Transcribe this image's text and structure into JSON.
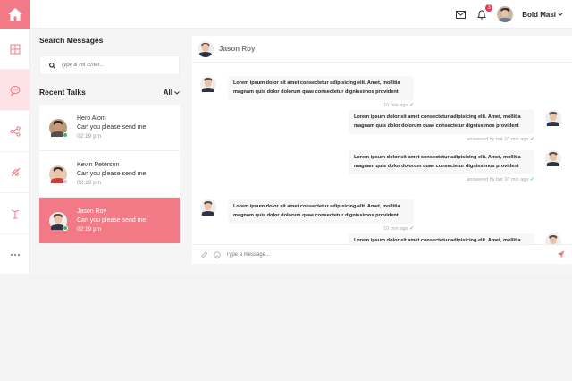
{
  "header": {
    "user_name": "Bold Masi",
    "notification_count": "3"
  },
  "left": {
    "search_title": "Search Messages",
    "search_placeholder": "Type & Hit Enter...",
    "recent_title": "Recent Talks",
    "filter_label": "All"
  },
  "contacts": [
    {
      "name": "Hero Alom",
      "message": "Can you please send me",
      "time": "02:19 pm",
      "status_color": "#3ab36a"
    },
    {
      "name": "Kevin Peterson",
      "message": "Can you please send me",
      "time": "02:19 pm",
      "status_color": "#c9c9c9"
    },
    {
      "name": "Jason Roy",
      "message": "Can you please send me",
      "time": "02:19 pm",
      "status_color": "#3ab36a"
    }
  ],
  "chat": {
    "title": "Jason Roy",
    "composer_placeholder": "Type a message...",
    "messages": [
      {
        "direction": "in",
        "text": "Lorem ipsum dolor sit amet consectetur adipisicing elit. Amet, mollitia magnam quis dolor dolorum quae consectetur dignissimos provident",
        "meta": "10 min ago"
      },
      {
        "direction": "out",
        "text": "Lorem ipsum dolor sit amet consectetur adipisicing elit. Amet, mollitia magnam quis dolor dolorum quae consectetur dignissimos provident",
        "meta": "answered by bot 10 min ago"
      },
      {
        "direction": "out",
        "text": "Lorem ipsum dolor sit amet consectetur adipisicing elit. Amet, mollitia magnam quis dolor dolorum quae consectetur dignissimos provident",
        "meta": "answered by bot 10 min ago"
      },
      {
        "direction": "in",
        "text": "Lorem ipsum dolor sit amet consectetur adipisicing elit. Amet, mollitia magnam quis dolor dolorum quae consectetur dignissimos provident",
        "meta": "10 min ago"
      },
      {
        "direction": "out",
        "text": "Lorem ipsum dolor sit amet consectetur adipisicing elit. Amet, mollitia",
        "meta": ""
      }
    ]
  },
  "colors": {
    "accent": "#f27a86",
    "online": "#3ab36a"
  },
  "icons": {
    "rail": [
      "home-icon",
      "grid-icon",
      "chat-icon",
      "share-icon",
      "rocket-icon",
      "antenna-icon",
      "more-icon"
    ],
    "header": [
      "mail-icon",
      "bell-icon"
    ]
  }
}
